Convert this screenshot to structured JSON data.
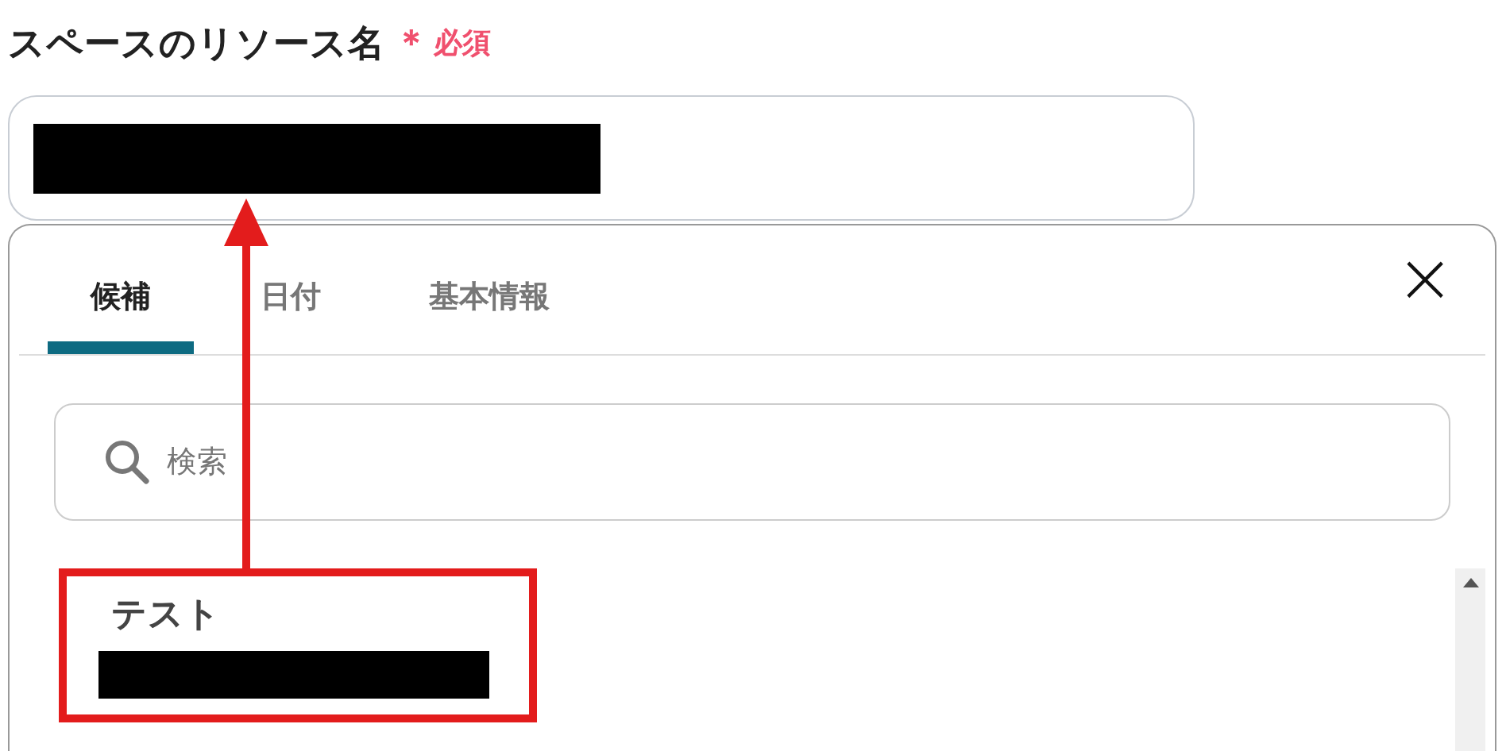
{
  "field": {
    "label": "スペースのリソース名",
    "required_mark": "＊",
    "required_text": "必須"
  },
  "panel": {
    "tabs": [
      {
        "label": "候補",
        "selected": true
      },
      {
        "label": "日付",
        "selected": false
      },
      {
        "label": "基本情報",
        "selected": false
      }
    ],
    "close": "×",
    "search": {
      "placeholder": "検索"
    },
    "items": [
      {
        "title": "テスト",
        "highlighted": true
      }
    ]
  }
}
